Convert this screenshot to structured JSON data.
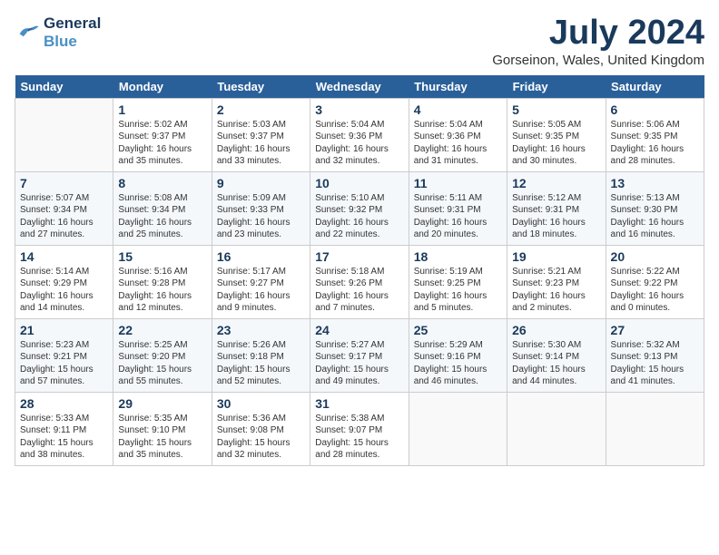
{
  "logo": {
    "line1": "General",
    "line2": "Blue"
  },
  "title": "July 2024",
  "location": "Gorseinon, Wales, United Kingdom",
  "days_of_week": [
    "Sunday",
    "Monday",
    "Tuesday",
    "Wednesday",
    "Thursday",
    "Friday",
    "Saturday"
  ],
  "weeks": [
    [
      {
        "day": "",
        "info": ""
      },
      {
        "day": "1",
        "info": "Sunrise: 5:02 AM\nSunset: 9:37 PM\nDaylight: 16 hours\nand 35 minutes."
      },
      {
        "day": "2",
        "info": "Sunrise: 5:03 AM\nSunset: 9:37 PM\nDaylight: 16 hours\nand 33 minutes."
      },
      {
        "day": "3",
        "info": "Sunrise: 5:04 AM\nSunset: 9:36 PM\nDaylight: 16 hours\nand 32 minutes."
      },
      {
        "day": "4",
        "info": "Sunrise: 5:04 AM\nSunset: 9:36 PM\nDaylight: 16 hours\nand 31 minutes."
      },
      {
        "day": "5",
        "info": "Sunrise: 5:05 AM\nSunset: 9:35 PM\nDaylight: 16 hours\nand 30 minutes."
      },
      {
        "day": "6",
        "info": "Sunrise: 5:06 AM\nSunset: 9:35 PM\nDaylight: 16 hours\nand 28 minutes."
      }
    ],
    [
      {
        "day": "7",
        "info": "Sunrise: 5:07 AM\nSunset: 9:34 PM\nDaylight: 16 hours\nand 27 minutes."
      },
      {
        "day": "8",
        "info": "Sunrise: 5:08 AM\nSunset: 9:34 PM\nDaylight: 16 hours\nand 25 minutes."
      },
      {
        "day": "9",
        "info": "Sunrise: 5:09 AM\nSunset: 9:33 PM\nDaylight: 16 hours\nand 23 minutes."
      },
      {
        "day": "10",
        "info": "Sunrise: 5:10 AM\nSunset: 9:32 PM\nDaylight: 16 hours\nand 22 minutes."
      },
      {
        "day": "11",
        "info": "Sunrise: 5:11 AM\nSunset: 9:31 PM\nDaylight: 16 hours\nand 20 minutes."
      },
      {
        "day": "12",
        "info": "Sunrise: 5:12 AM\nSunset: 9:31 PM\nDaylight: 16 hours\nand 18 minutes."
      },
      {
        "day": "13",
        "info": "Sunrise: 5:13 AM\nSunset: 9:30 PM\nDaylight: 16 hours\nand 16 minutes."
      }
    ],
    [
      {
        "day": "14",
        "info": "Sunrise: 5:14 AM\nSunset: 9:29 PM\nDaylight: 16 hours\nand 14 minutes."
      },
      {
        "day": "15",
        "info": "Sunrise: 5:16 AM\nSunset: 9:28 PM\nDaylight: 16 hours\nand 12 minutes."
      },
      {
        "day": "16",
        "info": "Sunrise: 5:17 AM\nSunset: 9:27 PM\nDaylight: 16 hours\nand 9 minutes."
      },
      {
        "day": "17",
        "info": "Sunrise: 5:18 AM\nSunset: 9:26 PM\nDaylight: 16 hours\nand 7 minutes."
      },
      {
        "day": "18",
        "info": "Sunrise: 5:19 AM\nSunset: 9:25 PM\nDaylight: 16 hours\nand 5 minutes."
      },
      {
        "day": "19",
        "info": "Sunrise: 5:21 AM\nSunset: 9:23 PM\nDaylight: 16 hours\nand 2 minutes."
      },
      {
        "day": "20",
        "info": "Sunrise: 5:22 AM\nSunset: 9:22 PM\nDaylight: 16 hours\nand 0 minutes."
      }
    ],
    [
      {
        "day": "21",
        "info": "Sunrise: 5:23 AM\nSunset: 9:21 PM\nDaylight: 15 hours\nand 57 minutes."
      },
      {
        "day": "22",
        "info": "Sunrise: 5:25 AM\nSunset: 9:20 PM\nDaylight: 15 hours\nand 55 minutes."
      },
      {
        "day": "23",
        "info": "Sunrise: 5:26 AM\nSunset: 9:18 PM\nDaylight: 15 hours\nand 52 minutes."
      },
      {
        "day": "24",
        "info": "Sunrise: 5:27 AM\nSunset: 9:17 PM\nDaylight: 15 hours\nand 49 minutes."
      },
      {
        "day": "25",
        "info": "Sunrise: 5:29 AM\nSunset: 9:16 PM\nDaylight: 15 hours\nand 46 minutes."
      },
      {
        "day": "26",
        "info": "Sunrise: 5:30 AM\nSunset: 9:14 PM\nDaylight: 15 hours\nand 44 minutes."
      },
      {
        "day": "27",
        "info": "Sunrise: 5:32 AM\nSunset: 9:13 PM\nDaylight: 15 hours\nand 41 minutes."
      }
    ],
    [
      {
        "day": "28",
        "info": "Sunrise: 5:33 AM\nSunset: 9:11 PM\nDaylight: 15 hours\nand 38 minutes."
      },
      {
        "day": "29",
        "info": "Sunrise: 5:35 AM\nSunset: 9:10 PM\nDaylight: 15 hours\nand 35 minutes."
      },
      {
        "day": "30",
        "info": "Sunrise: 5:36 AM\nSunset: 9:08 PM\nDaylight: 15 hours\nand 32 minutes."
      },
      {
        "day": "31",
        "info": "Sunrise: 5:38 AM\nSunset: 9:07 PM\nDaylight: 15 hours\nand 28 minutes."
      },
      {
        "day": "",
        "info": ""
      },
      {
        "day": "",
        "info": ""
      },
      {
        "day": "",
        "info": ""
      }
    ]
  ]
}
